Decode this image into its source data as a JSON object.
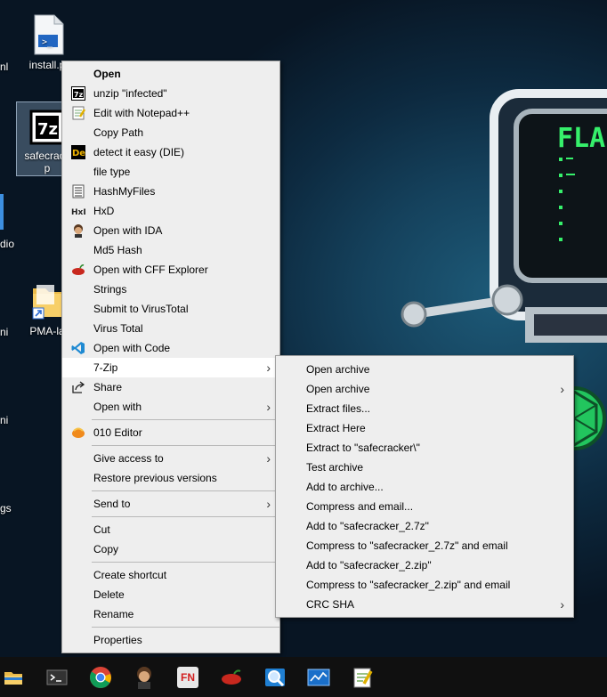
{
  "desktop": {
    "icons": [
      {
        "label": "install.p",
        "name": "powershell-script-icon"
      },
      {
        "label": "safecrack",
        "label2": "p",
        "name": "7zip-archive-icon"
      },
      {
        "label": "PMA-la",
        "name": "folder-shortcut-icon"
      }
    ],
    "edge_labels": [
      "nl",
      "dio",
      "ni",
      "ni",
      "gs"
    ]
  },
  "context_menu": {
    "items": [
      {
        "label": "Open",
        "icon": "",
        "bold": true
      },
      {
        "label": "unzip \"infected\"",
        "icon": "7zip-icon"
      },
      {
        "label": "Edit with Notepad++",
        "icon": "notepad-plus-plus-icon"
      },
      {
        "label": "Copy Path",
        "icon": ""
      },
      {
        "label": "detect it easy (DIE)",
        "icon": "die-icon"
      },
      {
        "label": "file type",
        "icon": ""
      },
      {
        "label": "HashMyFiles",
        "icon": "hashmyfiles-icon"
      },
      {
        "label": "HxD",
        "icon": "hxd-icon"
      },
      {
        "label": "Open with IDA",
        "icon": "ida-icon"
      },
      {
        "label": "Md5 Hash",
        "icon": ""
      },
      {
        "label": "Open with CFF Explorer",
        "icon": "cff-explorer-icon"
      },
      {
        "label": "Strings",
        "icon": ""
      },
      {
        "label": "Submit to VirusTotal",
        "icon": ""
      },
      {
        "label": "Virus Total",
        "icon": ""
      },
      {
        "label": "Open with Code",
        "icon": "vscode-icon"
      },
      {
        "label": "7-Zip",
        "icon": "",
        "submenu": true,
        "highlighted": true
      },
      {
        "label": "Share",
        "icon": "share-icon"
      },
      {
        "label": "Open with",
        "icon": "",
        "submenu": true
      },
      {
        "separator": true
      },
      {
        "label": "010 Editor",
        "icon": "010-editor-icon"
      },
      {
        "separator": true
      },
      {
        "label": "Give access to",
        "icon": "",
        "submenu": true
      },
      {
        "label": "Restore previous versions",
        "icon": ""
      },
      {
        "separator": true
      },
      {
        "label": "Send to",
        "icon": "",
        "submenu": true
      },
      {
        "separator": true
      },
      {
        "label": "Cut",
        "icon": ""
      },
      {
        "label": "Copy",
        "icon": ""
      },
      {
        "separator": true
      },
      {
        "label": "Create shortcut",
        "icon": ""
      },
      {
        "label": "Delete",
        "icon": ""
      },
      {
        "label": "Rename",
        "icon": ""
      },
      {
        "separator": true
      },
      {
        "label": "Properties",
        "icon": ""
      }
    ]
  },
  "submenu_7zip": {
    "items": [
      {
        "label": "Open archive"
      },
      {
        "label": "Open archive",
        "submenu": true
      },
      {
        "label": "Extract files..."
      },
      {
        "label": "Extract Here"
      },
      {
        "label": "Extract to \"safecracker\\\""
      },
      {
        "label": "Test archive"
      },
      {
        "label": "Add to archive..."
      },
      {
        "label": "Compress and email..."
      },
      {
        "label": "Add to \"safecracker_2.7z\""
      },
      {
        "label": "Compress to \"safecracker_2.7z\" and email"
      },
      {
        "label": "Add to \"safecracker_2.zip\""
      },
      {
        "label": "Compress to \"safecracker_2.zip\" and email"
      },
      {
        "label": "CRC SHA",
        "submenu": true
      }
    ]
  },
  "wallpaper": {
    "text": "FLA"
  },
  "taskbar": {
    "items": [
      "file-explorer-icon",
      "terminal-icon",
      "chrome-icon",
      "ida-icon",
      "fakenet-icon",
      "cff-explorer-icon",
      "search-tool-icon",
      "performance-monitor-icon",
      "notepad-plus-plus-icon"
    ],
    "fakenet_label": "FN"
  }
}
